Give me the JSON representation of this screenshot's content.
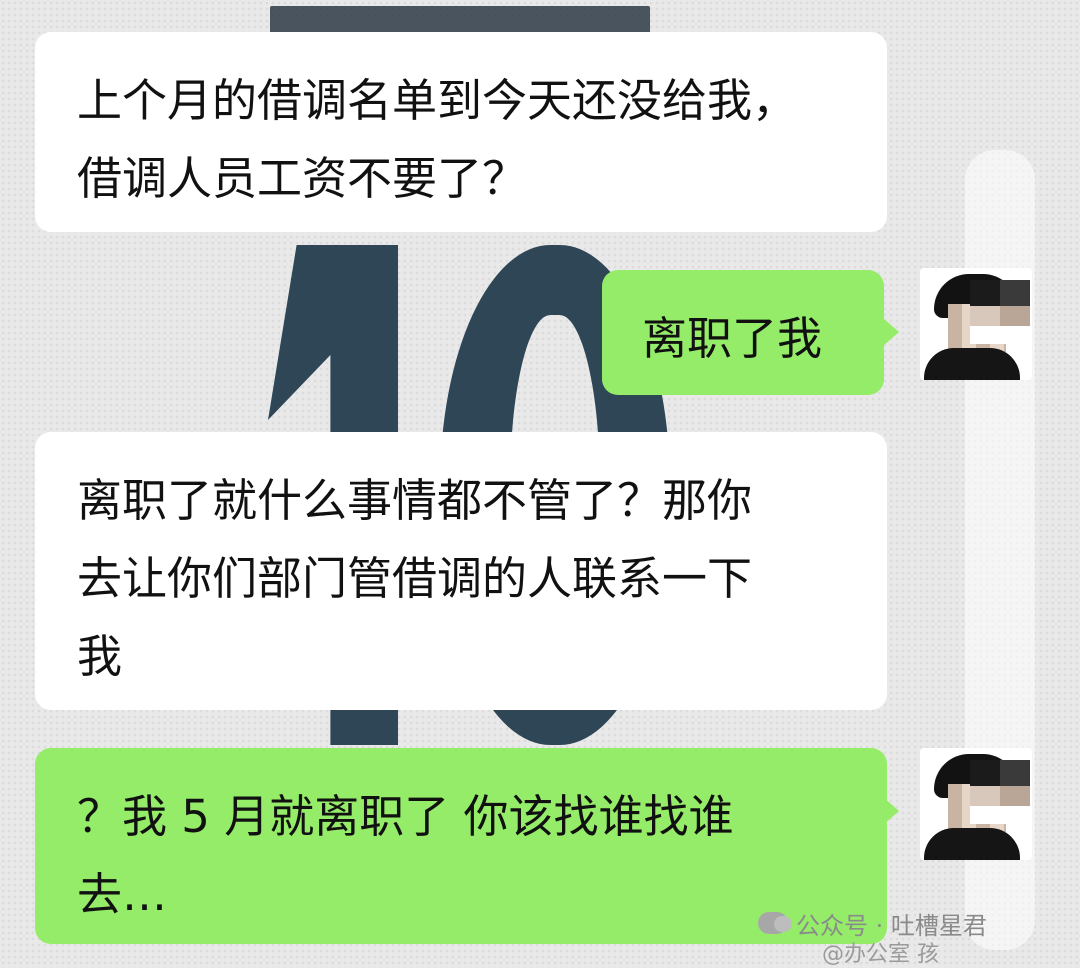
{
  "messages": [
    {
      "direction": "incoming",
      "text": "上个月的借调名单到今天还没给我，\n借调人员工资不要了？"
    },
    {
      "direction": "outgoing",
      "text": "离职了我"
    },
    {
      "direction": "incoming",
      "text": "离职了就什么事情都不管了？那你\n去让你们部门管借调的人联系一下\n我"
    },
    {
      "direction": "outgoing",
      "text": "？我 5 月就离职了 你该找谁找谁\n去…"
    }
  ],
  "watermark": {
    "text": "公众号 · 吐槽星君",
    "icon": "wechat-icon"
  },
  "credit": {
    "text": "@办公室  孩"
  },
  "colors": {
    "incoming_bubble": "#ffffff",
    "outgoing_bubble": "#95ec69"
  }
}
